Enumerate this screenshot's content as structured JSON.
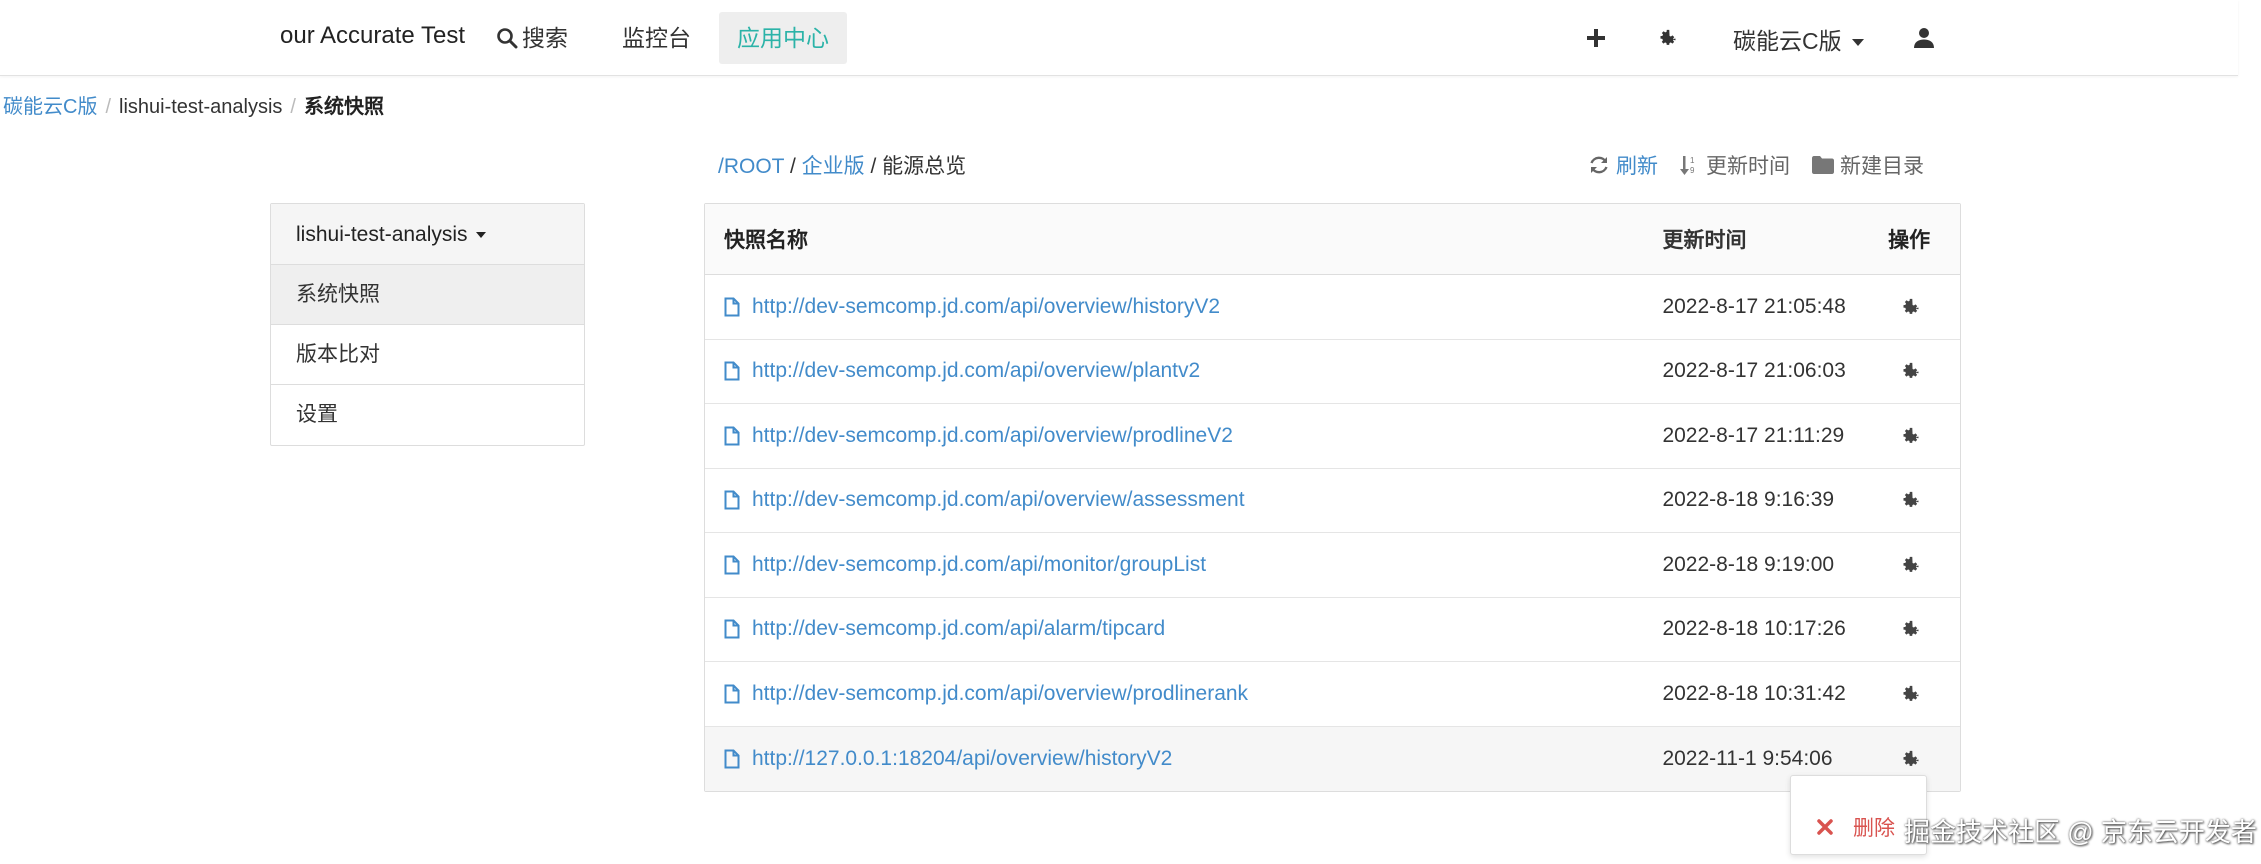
{
  "header": {
    "brand": "our Accurate Test",
    "search_label": "搜索",
    "console_label": "监控台",
    "app_center_label": "应用中心",
    "org_label": "碳能云C版"
  },
  "breadcrumb": {
    "root": "碳能云C版",
    "project": "lishui-test-analysis",
    "current": "系统快照"
  },
  "sidebar": {
    "project": "lishui-test-analysis",
    "items": [
      {
        "label": "系统快照"
      },
      {
        "label": "版本比对"
      },
      {
        "label": "设置"
      }
    ]
  },
  "path": {
    "root": "/ROOT",
    "sep1": " / ",
    "level1": "企业版",
    "sep2": " / ",
    "current": "能源总览"
  },
  "actions": {
    "refresh": "刷新",
    "sort_time": "更新时间",
    "new_dir": "新建目录"
  },
  "table": {
    "headers": {
      "name": "快照名称",
      "time": "更新时间",
      "op": "操作"
    },
    "rows": [
      {
        "name": "http://dev-semcomp.jd.com/api/overview/historyV2",
        "time": "2022-8-17 21:05:48"
      },
      {
        "name": "http://dev-semcomp.jd.com/api/overview/plantv2",
        "time": "2022-8-17 21:06:03"
      },
      {
        "name": "http://dev-semcomp.jd.com/api/overview/prodlineV2",
        "time": "2022-8-17 21:11:29"
      },
      {
        "name": "http://dev-semcomp.jd.com/api/overview/assessment",
        "time": "2022-8-18 9:16:39"
      },
      {
        "name": "http://dev-semcomp.jd.com/api/monitor/groupList",
        "time": "2022-8-18 9:19:00"
      },
      {
        "name": "http://dev-semcomp.jd.com/api/alarm/tipcard",
        "time": "2022-8-18 10:17:26"
      },
      {
        "name": "http://dev-semcomp.jd.com/api/overview/prodlinerank",
        "time": "2022-8-18 10:31:42"
      },
      {
        "name": "http://127.0.0.1:18204/api/overview/historyV2",
        "time": "2022-11-1 9:54:06"
      }
    ]
  },
  "popup": {
    "delete_label": "删除"
  },
  "watermark": "掘金技术社区 @ 京东云开发者",
  "colors": {
    "link": "#428bca",
    "active_nav": "#2bb3a8",
    "danger": "#d9534f"
  }
}
